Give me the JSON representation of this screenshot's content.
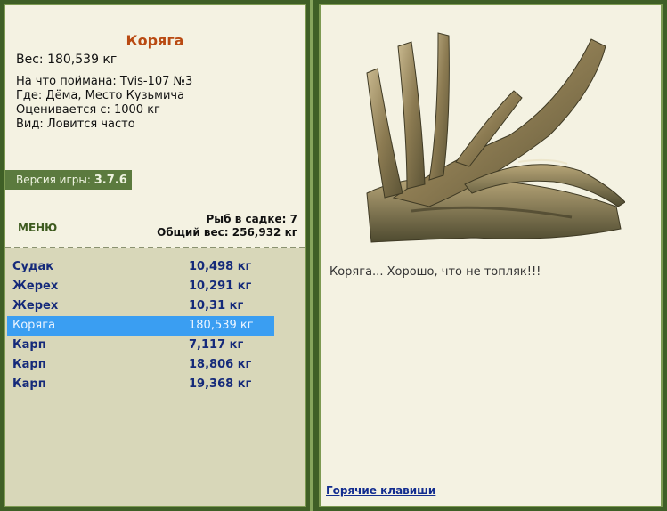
{
  "selected_fish": {
    "name": "Коряга",
    "weight_line": "Вес: 180,539 кг",
    "caught_with": "На что поймана: Tvis-107 №3",
    "where": "Где: Дёма, Место Кузьмича",
    "valued_from": "Оценивается с: 1000 кг",
    "kind": "Вид: Ловится часто",
    "description": "Коряга... Хорошо, что не топляк!!!"
  },
  "version": {
    "label": "Версия игры:",
    "value": "3.7.6"
  },
  "menu": {
    "label": "МЕНЮ"
  },
  "cage": {
    "fish_count": "Рыб в садке: 7",
    "total_weight": "Общий вес: 256,932 кг"
  },
  "fish_list": [
    {
      "name": "Судак",
      "weight": "10,498 кг"
    },
    {
      "name": "Жерех",
      "weight": "10,291 кг"
    },
    {
      "name": "Жерех",
      "weight": "10,31 кг"
    },
    {
      "name": "Коряга",
      "weight": "180,539 кг"
    },
    {
      "name": "Карп",
      "weight": "7,117 кг"
    },
    {
      "name": "Карп",
      "weight": "18,806 кг"
    },
    {
      "name": "Карп",
      "weight": "19,368 кг"
    }
  ],
  "hotkeys": {
    "label": "Горячие клавиши"
  },
  "colors": {
    "title": "#b94a12",
    "selected_row": "#3a9ef2",
    "list_text": "#152a7a",
    "version_bar": "#5b7a3e"
  }
}
